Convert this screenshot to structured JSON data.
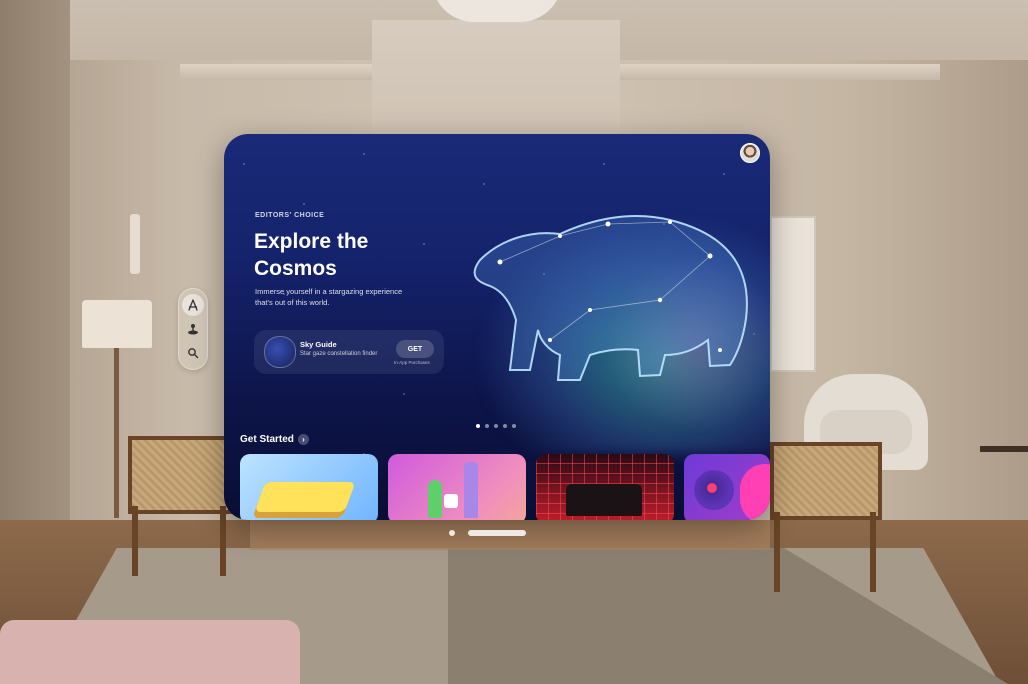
{
  "ornament": {
    "items": [
      {
        "icon": "app-store-icon",
        "active": true
      },
      {
        "icon": "arcade-icon",
        "active": false
      },
      {
        "icon": "search-icon",
        "active": false
      }
    ]
  },
  "hero": {
    "eyebrow": "EDITORS' CHOICE",
    "title": "Explore the Cosmos",
    "subtitle": "Immerse yourself in a stargazing experience that's out of this world.",
    "app": {
      "name": "Sky Guide",
      "tagline": "Star gaze constellation finder",
      "button_label": "GET",
      "iap_note": "In-App Purchases"
    },
    "page_count": 5,
    "current_page": 1
  },
  "get_started": {
    "title": "Get Started",
    "chevron": "›"
  },
  "colors": {
    "window_top": "#1a2a78",
    "window_bottom": "#0a0e33",
    "aurora": "#3cdcaa"
  }
}
